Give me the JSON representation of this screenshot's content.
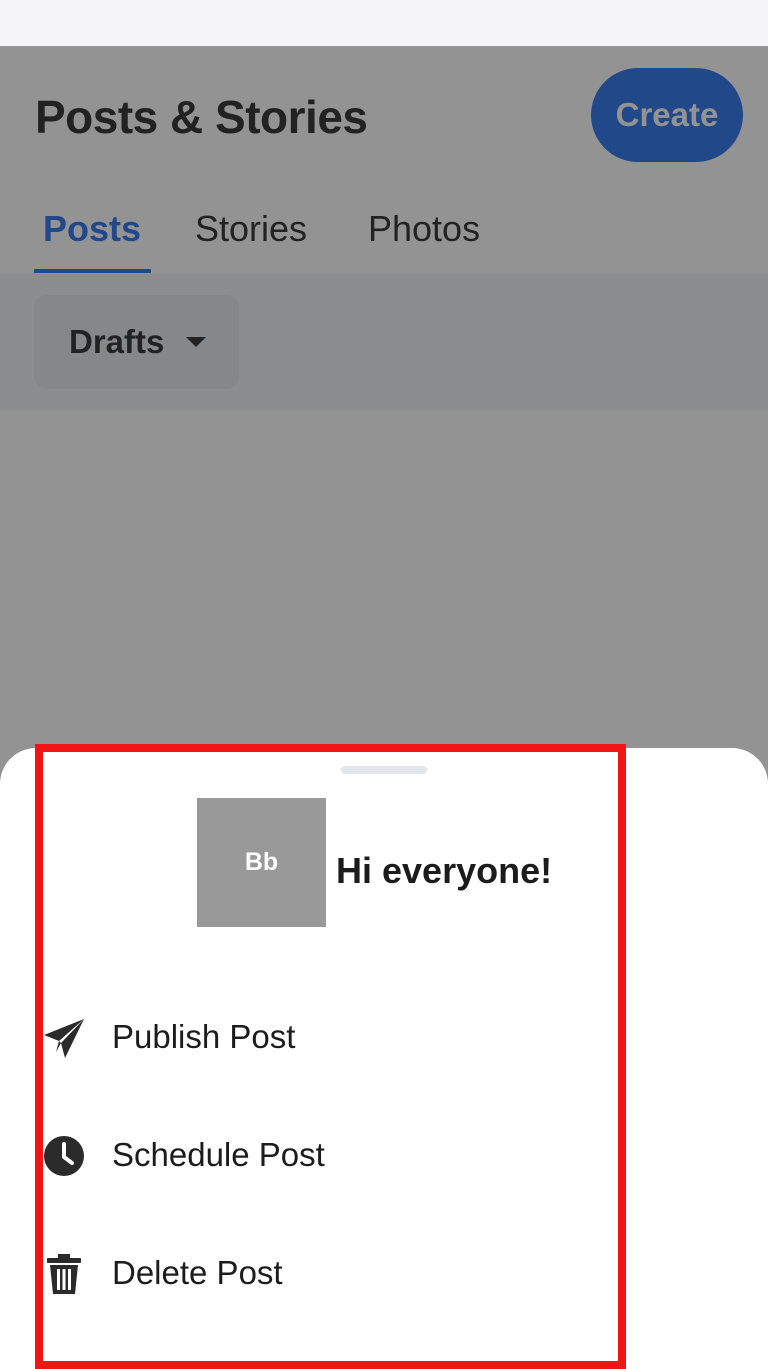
{
  "header": {
    "title": "Posts & Stories",
    "create_label": "Create"
  },
  "tabs": [
    {
      "label": "Posts",
      "active": true
    },
    {
      "label": "Stories",
      "active": false
    },
    {
      "label": "Photos",
      "active": false
    }
  ],
  "filter": {
    "selected": "Drafts",
    "icon": "caret-down-icon"
  },
  "sheet": {
    "thumbnail_text": "Bb",
    "post_title": "Hi everyone!",
    "actions": [
      {
        "label": "Publish Post",
        "icon": "paper-plane-icon"
      },
      {
        "label": "Schedule Post",
        "icon": "clock-icon"
      },
      {
        "label": "Delete Post",
        "icon": "trash-icon"
      }
    ]
  },
  "colors": {
    "accent": "#1a6bea",
    "highlight": "#f01616",
    "text": "#1c1c1c",
    "thumbnail_bg": "#999999"
  }
}
